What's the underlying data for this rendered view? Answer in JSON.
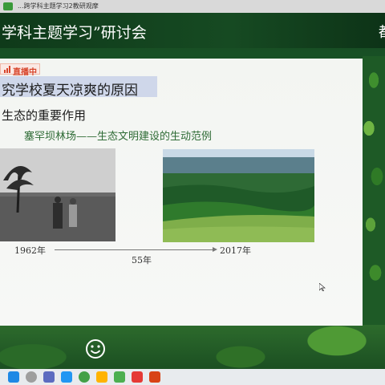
{
  "window": {
    "title_fragment": "...跨学科主题学习2教研观摩"
  },
  "stream_header": {
    "title": "学科主题学习”研讨会",
    "right_text": "都"
  },
  "slide": {
    "live_badge": "直播中",
    "heading": "究学校夏天凉爽的原因",
    "subheading": "生态的重要作用",
    "caption": "塞罕坝林场——生态文明建设的生动范例",
    "timeline": {
      "start_year": "1962年",
      "end_year": "2017年",
      "span": "55年"
    },
    "photos": [
      {
        "name": "1962 barren land with lone tree",
        "tone": "black-and-white"
      },
      {
        "name": "2017 forest landscape",
        "tone": "color"
      }
    ]
  },
  "controls": {
    "emoji_icon": "smiley-icon"
  },
  "taskbar": {
    "icons": [
      "windows-start-icon",
      "search-icon",
      "task-view-icon",
      "file-explorer-icon",
      "chrome-icon",
      "app-icon",
      "wechat-icon",
      "wps-icon",
      "app-red-icon"
    ]
  },
  "colors": {
    "header_bg": "#0f3a1a",
    "live_red": "#d7452b",
    "caption_green": "#2e6b35",
    "heading_bar": "#cfd7ea"
  }
}
